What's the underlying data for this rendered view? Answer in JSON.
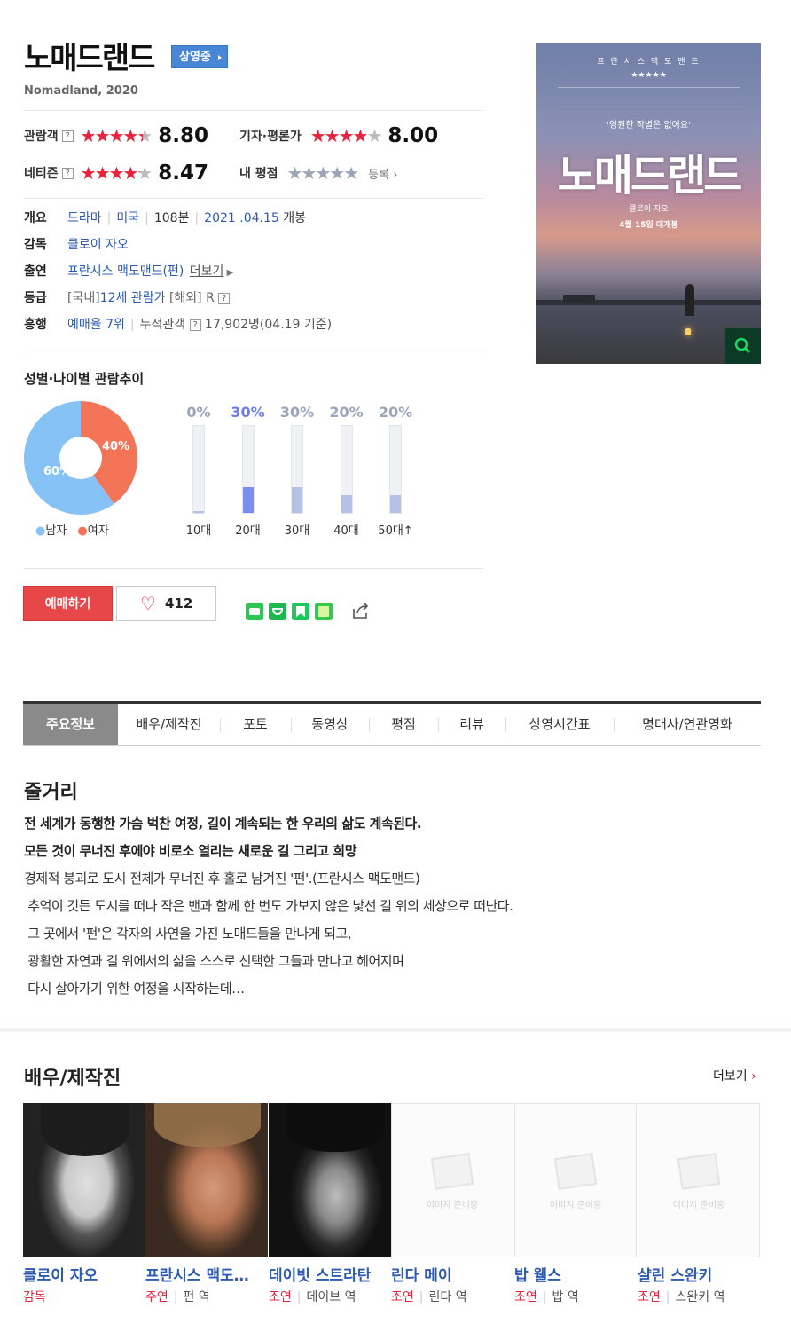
{
  "movie": {
    "title": "노매드랜드",
    "status_badge": "상영중",
    "subtitle": "Nomadland, 2020"
  },
  "ratings": {
    "audience": {
      "label": "관람객",
      "score": "8.80",
      "stars": 4.4
    },
    "critics": {
      "label": "기자·평론가",
      "score": "8.00",
      "stars": 4.0
    },
    "netizen": {
      "label": "네티즌",
      "score": "8.47",
      "stars": 4.2
    },
    "my": {
      "label": "내 평점",
      "register": "등록"
    }
  },
  "info": {
    "overview_label": "개요",
    "genre": "드라마",
    "country": "미국",
    "runtime": "108분",
    "release_date": "2021 .04.15",
    "release_suffix": "개봉",
    "director_label": "감독",
    "director": "클로이 자오",
    "cast_label": "출연",
    "cast": "프란시스 맥도맨드(펀)",
    "cast_more": "더보기",
    "grade_label": "등급",
    "grade_prefix": "[국내]",
    "grade_kr": "12세 관람가",
    "grade_foreign": "[해외] R",
    "box_label": "흥행",
    "reservation": "예매율 7위",
    "cumulative_label": "누적관객",
    "cumulative_value": "17,902명(04.19 기준)"
  },
  "demographics": {
    "title": "성별·나이별 관람추이",
    "gender": [
      {
        "label": "남자",
        "pct": 60,
        "text": "60%",
        "color": "#86c2f5"
      },
      {
        "label": "여자",
        "pct": 40,
        "text": "40%",
        "color": "#f47458"
      }
    ],
    "ages": [
      {
        "label": "10대",
        "pct": 0,
        "text": "0%"
      },
      {
        "label": "20대",
        "pct": 30,
        "text": "30%"
      },
      {
        "label": "30대",
        "pct": 30,
        "text": "30%"
      },
      {
        "label": "40대",
        "pct": 20,
        "text": "20%"
      },
      {
        "label": "50대↑",
        "pct": 20,
        "text": "20%"
      }
    ]
  },
  "actions": {
    "book": "예매하기",
    "likes": "412"
  },
  "tabs": [
    "주요정보",
    "배우/제작진",
    "포토",
    "동영상",
    "평점",
    "리뷰",
    "상영시간표",
    "명대사/연관영화"
  ],
  "plot": {
    "heading": "줄거리",
    "lines_bold": [
      "전 세계가 동행한 가슴 벅찬 여정, 길이 계속되는 한 우리의 삶도 계속된다.",
      "모든 것이 무너진 후에야 비로소 열리는 새로운 길 그리고 희망"
    ],
    "lines": [
      "경제적 붕괴로 도시 전체가 무너진 후 홀로 남겨진 '펀'.(프란시스 맥도맨드)",
      " 추억이 깃든 도시를 떠나 작은 밴과 함께 한 번도 가보지 않은 낯선 길 위의 세상으로 떠난다.",
      " 그 곳에서 '펀'은 각자의 사연을 가진 노매드들을 만나게 되고,",
      " 광활한 자연과 길 위에서의 삶을 스스로 선택한 그들과 만나고 헤어지며",
      " 다시 살아가기 위한 여정을 시작하는데…"
    ]
  },
  "poster": {
    "top_text": "프 란 시 스   맥 도 맨 드",
    "stars": "★★★★★",
    "tagline": "'영원한 작별은 없어요'",
    "title": "노매드랜드",
    "director": "클로이 자오",
    "date": "4월 15일 대개봉"
  },
  "cast_section": {
    "heading": "배우/제작진",
    "more": "더보기",
    "no_image": "이미지 준비중",
    "people": [
      {
        "name": "클로이 자오",
        "role": "감독",
        "character": ""
      },
      {
        "name": "프란시스 맥도…",
        "role": "주연",
        "character": "펀 역"
      },
      {
        "name": "데이빗 스트라탄",
        "role": "조연",
        "character": "데이브 역"
      },
      {
        "name": "린다 메이",
        "role": "조연",
        "character": "린다 역"
      },
      {
        "name": "밥 웰스",
        "role": "조연",
        "character": "밥 역"
      },
      {
        "name": "샬린 스완키",
        "role": "조연",
        "character": "스완키 역"
      }
    ]
  }
}
